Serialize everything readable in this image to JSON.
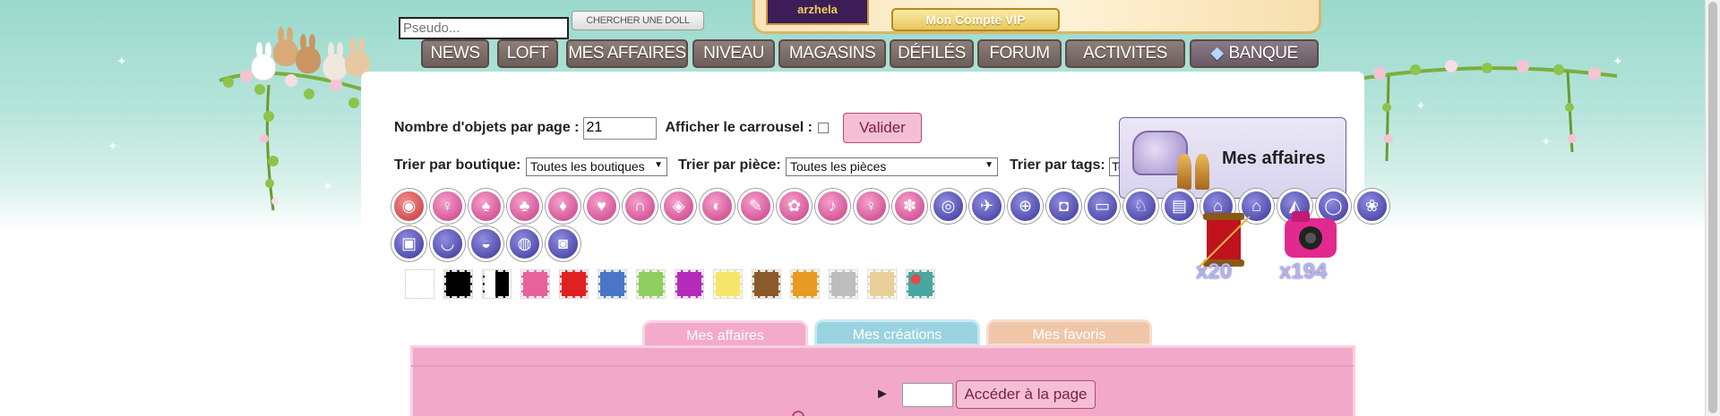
{
  "topbar": {
    "pseudo_placeholder": "Pseudo...",
    "search_doll_label": "CHERCHER UNE DOLL",
    "logo_text": "arzhela",
    "vip_label": "Mon Compte VIP"
  },
  "nav": {
    "items": [
      "NEWS",
      "LOFT",
      "MES AFFAIRES",
      "NIVEAU",
      "MAGASINS",
      "DÉFILÉS",
      "FORUM",
      "ACTIVITES"
    ],
    "bank_label": "BANQUE"
  },
  "filters": {
    "per_page_label": "Nombre d'objets par page :",
    "per_page_value": "21",
    "carousel_label": "Afficher le carrousel :",
    "validate_label": "Valider",
    "shop_label": "Trier par boutique:",
    "shop_value": "Toutes les boutiques",
    "room_label": "Trier par pièce:",
    "room_value": "Toutes les pièces",
    "tags_label": "Trier par tags:",
    "tags_value": "To"
  },
  "card": {
    "title": "Mes affaires"
  },
  "categories": {
    "row1": [
      "pink",
      "pink",
      "pink",
      "pink",
      "pink",
      "pink",
      "pink",
      "pink",
      "pink",
      "pink",
      "pink",
      "pink",
      "pink",
      "pink",
      "blue",
      "blue",
      "blue",
      "blue",
      "blue",
      "blue",
      "blue",
      "blue",
      "blue",
      "blue",
      "blue",
      "blue"
    ],
    "row2": [
      "blue",
      "blue",
      "blue",
      "blue",
      "blue"
    ]
  },
  "swatches": [
    "#ffffff",
    "#000000",
    "#000000",
    "#e8619a",
    "#e02121",
    "#4a76c7",
    "#8fcf5f",
    "#b42bbb",
    "#f5e66b",
    "#8a5a2a",
    "#e89a22",
    "#bdbdbd",
    "#e8cf9a",
    "#e04a4a"
  ],
  "inventory": {
    "spool_count": "x20",
    "camera_count": "x194"
  },
  "tabs": {
    "active": "Mes affaires",
    "creations": "Mes créations",
    "favorites": "Mes favoris"
  },
  "pagination": {
    "goto_label": "Accéder à la page",
    "arrow": "►"
  }
}
